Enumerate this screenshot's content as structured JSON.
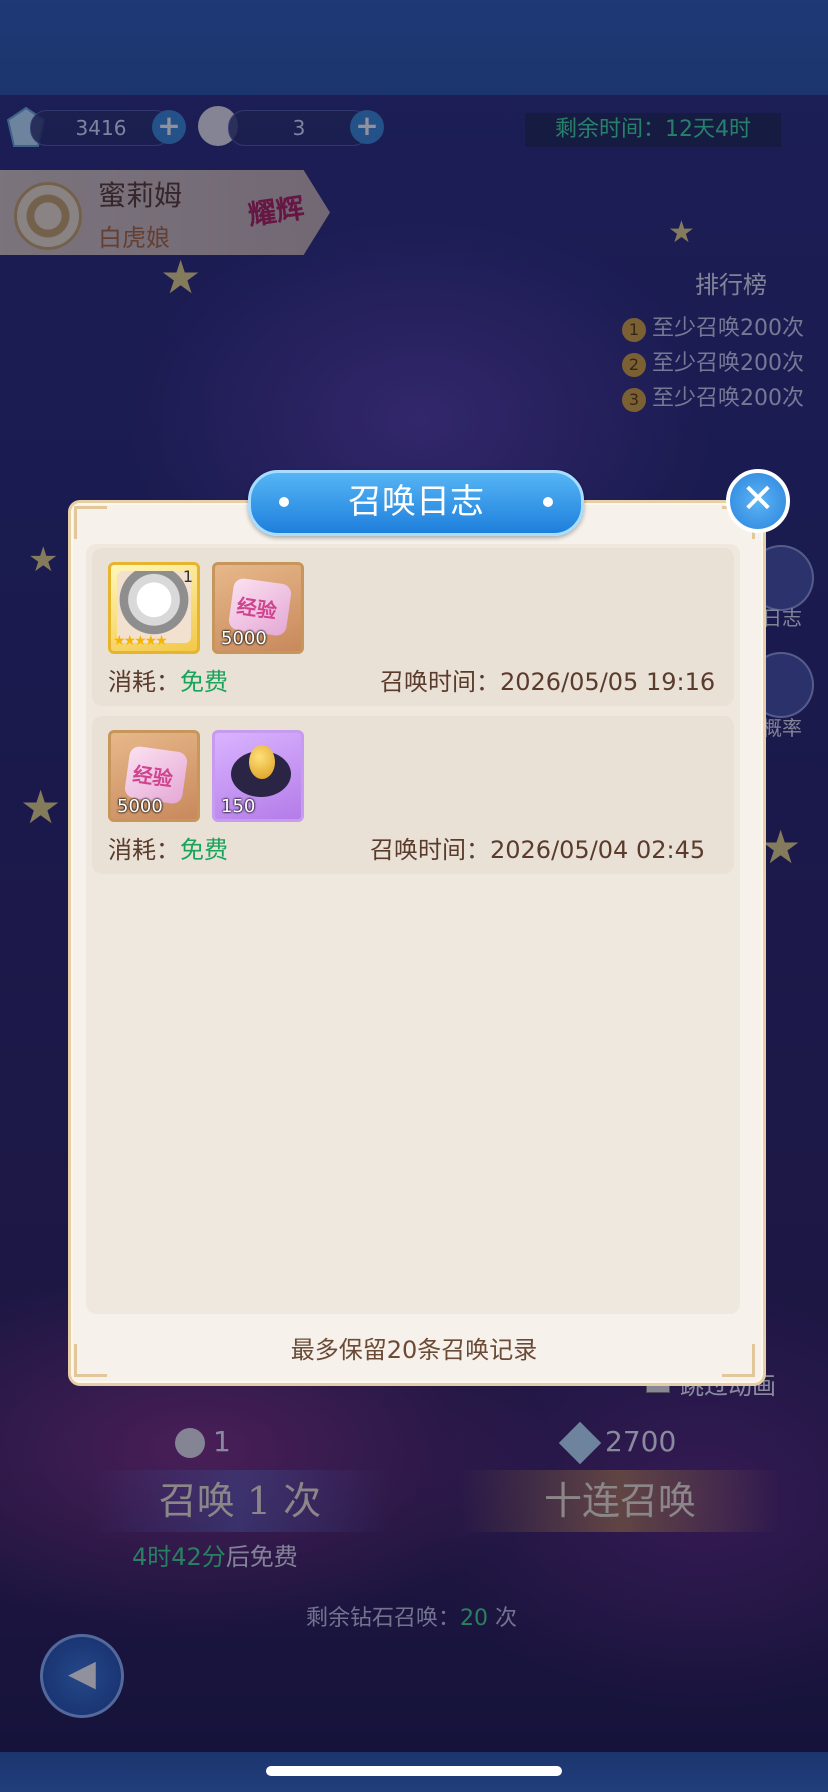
{
  "resources": {
    "gems": "3416",
    "pull_tokens": "3",
    "time_remaining_label": "剩余时间：12天4时"
  },
  "character": {
    "name": "蜜莉姆",
    "subtitle": "白虎娘",
    "badge": "耀辉"
  },
  "ranking": {
    "title": "排行榜",
    "rows": [
      {
        "rank": "1",
        "text": "至少召唤200次"
      },
      {
        "rank": "2",
        "text": "至少召唤200次"
      },
      {
        "rank": "3",
        "text": "至少召唤200次"
      }
    ]
  },
  "side_buttons": {
    "log_label": "日志",
    "rate_label": "概率"
  },
  "summon": {
    "single_cost": "1",
    "ten_cost": "2700",
    "single_label": "召唤 1 次",
    "ten_label": "十连召唤",
    "free_timer": "4时42分",
    "free_suffix": "后免费",
    "remaining_prefix": "剩余钻石召唤：",
    "remaining_count": "20",
    "remaining_suffix": " 次",
    "skip_label": "跳过动画"
  },
  "modal": {
    "title": "召唤日志",
    "entries": [
      {
        "items": [
          {
            "type": "character",
            "level": "1",
            "stars": "★★★★★"
          },
          {
            "type": "exp",
            "icon_text": "经验",
            "qty": "5000"
          }
        ],
        "cost_label": "消耗：",
        "cost_value": "免费",
        "time_label": "召唤时间：",
        "time_value": "2026/05/05 19:16"
      },
      {
        "items": [
          {
            "type": "exp",
            "icon_text": "经验",
            "qty": "5000"
          },
          {
            "type": "egg",
            "qty": "150"
          }
        ],
        "cost_label": "消耗：",
        "cost_value": "免费",
        "time_label": "召唤时间：",
        "time_value": "2026/05/04 02:45"
      }
    ],
    "footer": "最多保留20条召唤记录"
  },
  "colors": {
    "accent_blue": "#1e7fdc",
    "free_green": "#1aa35a",
    "modal_bg": "#f6f1ea"
  }
}
